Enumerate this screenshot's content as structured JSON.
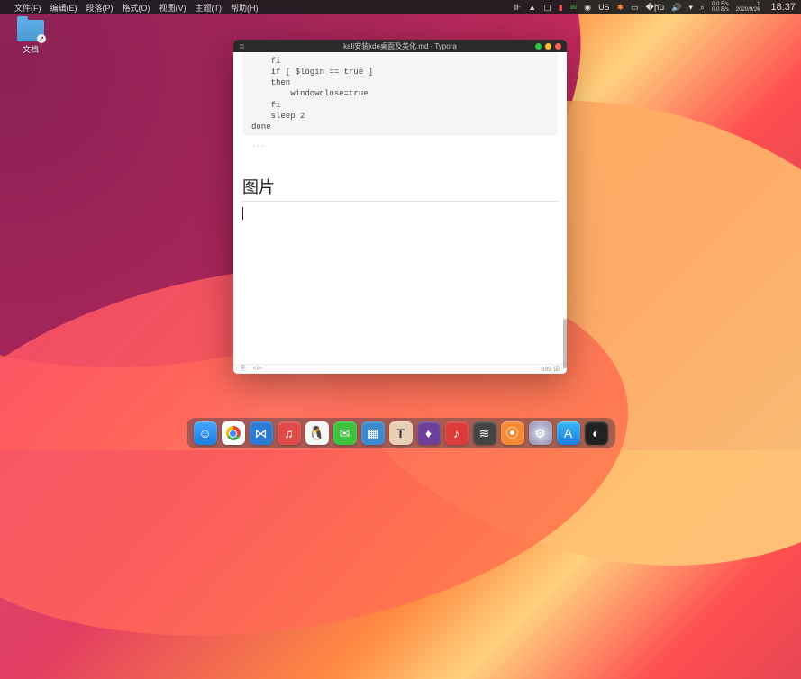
{
  "menubar": {
    "items": [
      "文件(F)",
      "编辑(E)",
      "段落(P)",
      "格式(O)",
      "视图(V)",
      "主题(T)",
      "帮助(H)"
    ],
    "tray": {
      "locale": "US",
      "net_up": "0.0 B/s",
      "net_down": "0.0 B/s",
      "time": "18:37",
      "date": "1",
      "fulldate": "2020/9/26"
    }
  },
  "desktop": {
    "folder_label": "文档"
  },
  "window": {
    "title": "kali安装kde桌面及美化.md - Typora",
    "code": "    fi\n    if [ $login == true ]\n    then\n        windowclose=true\n    fi\n    sleep 2\ndone",
    "code_footer": "...",
    "heading": "图片",
    "status_left_mode": "⎘",
    "status_left_source": "</>",
    "status_right": "699 词"
  },
  "dock": {
    "items": [
      {
        "name": "finder",
        "glyph": "☺"
      },
      {
        "name": "chrome",
        "glyph": ""
      },
      {
        "name": "vscode",
        "glyph": "⋈"
      },
      {
        "name": "netease",
        "glyph": "♫"
      },
      {
        "name": "qq",
        "glyph": "🐧"
      },
      {
        "name": "wechat",
        "glyph": "✉"
      },
      {
        "name": "dolphin",
        "glyph": "▦"
      },
      {
        "name": "text",
        "glyph": "T"
      },
      {
        "name": "flame",
        "glyph": "♦"
      },
      {
        "name": "music",
        "glyph": "♪"
      },
      {
        "name": "wifi",
        "glyph": "≋"
      },
      {
        "name": "rss",
        "glyph": "⦿"
      },
      {
        "name": "settings",
        "glyph": "⚙"
      },
      {
        "name": "appstore",
        "glyph": "A"
      },
      {
        "name": "dash",
        "glyph": "◐"
      }
    ]
  }
}
